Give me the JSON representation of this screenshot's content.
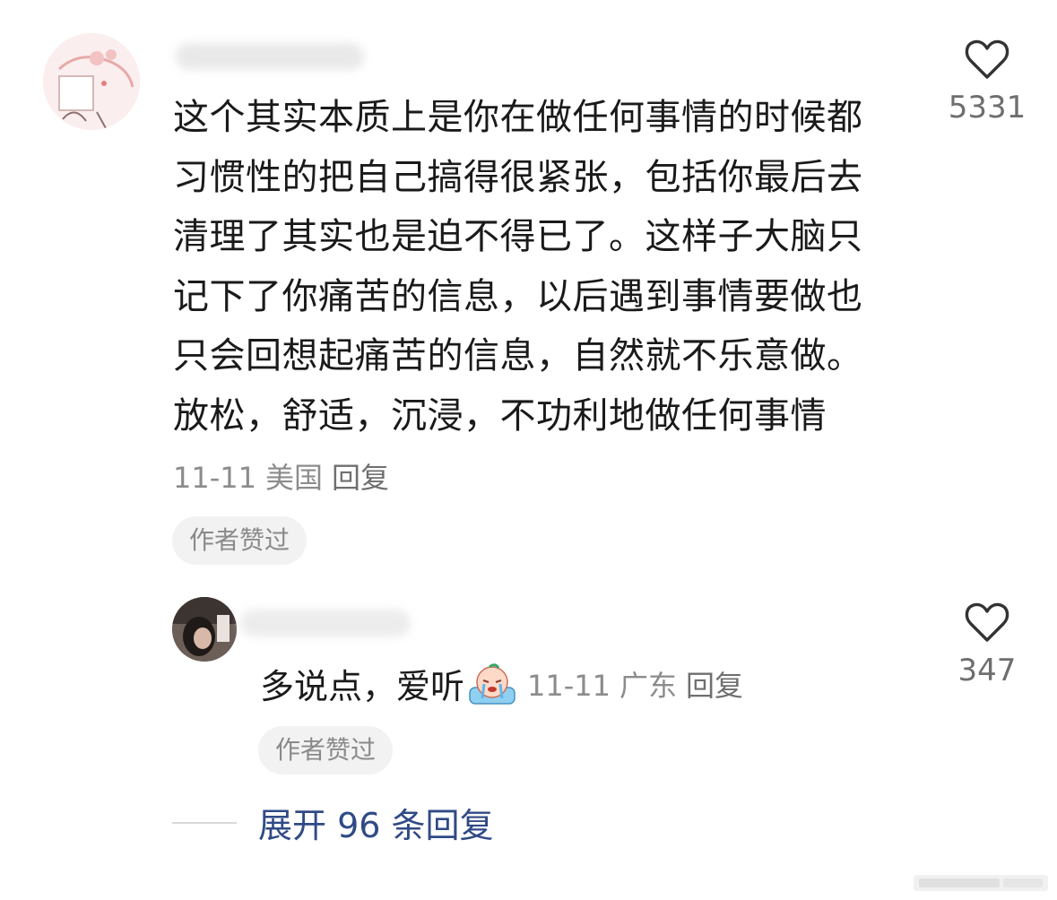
{
  "comment": {
    "lines": [
      "这个其实本质上是你在做任何事情的时候都",
      "习惯性的把自己搞得很紧张，包括你最后去",
      "清理了其实也是迫不得已了。这样子大脑只",
      "记下了你痛苦的信息，以后遇到事情要做也",
      "只会回想起痛苦的信息，自然就不乐意做。",
      "放松，舒适，沉浸，不功利地做任何事情"
    ],
    "date": "11-11",
    "location": "美国",
    "reply_label": "回复",
    "author_liked_badge": "作者赞过",
    "like_count": "5331"
  },
  "reply": {
    "text": "多说点，爱听",
    "emoji": "crying-face-emoji",
    "date": "11-11",
    "location": "广东",
    "reply_label": "回复",
    "author_liked_badge": "作者赞过",
    "like_count": "347"
  },
  "expand": {
    "label": "展开 96 条回复"
  },
  "colors": {
    "text_primary": "#1a1a1a",
    "text_secondary": "#8c8c8c",
    "link_blue": "#304a86",
    "chip_bg": "#f2f2f2"
  }
}
